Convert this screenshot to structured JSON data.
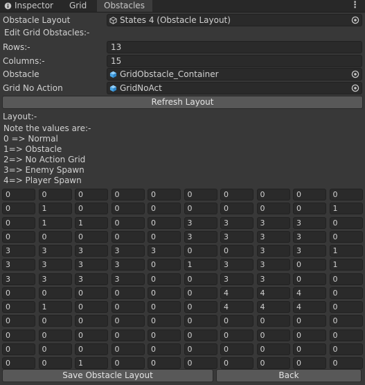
{
  "tabs": [
    {
      "label": "Inspector"
    },
    {
      "label": "Grid"
    },
    {
      "label": "Obstacles"
    }
  ],
  "fields": {
    "obstacle_layout_label": "Obstacle Layout",
    "obstacle_layout_value": "States 4 (Obstacle Layout)",
    "edit_grid_heading": "Edit Grid Obstacles:-",
    "rows_label": "Rows:-",
    "rows_value": "13",
    "columns_label": "Columns:-",
    "columns_value": "15",
    "obstacle_label": "Obstacle",
    "obstacle_value": "GridObstacle_Container",
    "grid_no_action_label": "Grid No Action",
    "grid_no_action_value": "GridNoAct"
  },
  "buttons": {
    "refresh": "Refresh Layout",
    "save": "Save Obstacle Layout",
    "back": "Back"
  },
  "legend": {
    "heading": "Layout:-",
    "note": "Note the values are:-",
    "items": [
      "0 => Normal",
      "1=> Obstacle",
      "2=> No Action Grid",
      "3=> Enemy Spawn",
      "4=> Player Spawn"
    ]
  },
  "grid": [
    [
      "0",
      "0",
      "0",
      "0",
      "0",
      "0",
      "0",
      "0",
      "0",
      "0"
    ],
    [
      "0",
      "1",
      "0",
      "0",
      "0",
      "0",
      "0",
      "0",
      "0",
      "1"
    ],
    [
      "0",
      "1",
      "1",
      "0",
      "0",
      "3",
      "3",
      "3",
      "3",
      "0"
    ],
    [
      "0",
      "0",
      "0",
      "0",
      "0",
      "3",
      "3",
      "3",
      "3",
      "0"
    ],
    [
      "3",
      "3",
      "3",
      "3",
      "3",
      "0",
      "0",
      "3",
      "3",
      "1"
    ],
    [
      "3",
      "3",
      "3",
      "3",
      "0",
      "1",
      "3",
      "3",
      "0",
      "1"
    ],
    [
      "3",
      "3",
      "3",
      "3",
      "0",
      "0",
      "3",
      "3",
      "0",
      "0"
    ],
    [
      "0",
      "0",
      "0",
      "0",
      "0",
      "0",
      "4",
      "4",
      "4",
      "0"
    ],
    [
      "0",
      "1",
      "0",
      "0",
      "0",
      "0",
      "4",
      "4",
      "4",
      "0"
    ],
    [
      "0",
      "0",
      "0",
      "0",
      "0",
      "0",
      "0",
      "0",
      "0",
      "0"
    ],
    [
      "0",
      "0",
      "0",
      "0",
      "0",
      "0",
      "0",
      "0",
      "0",
      "0"
    ],
    [
      "0",
      "0",
      "0",
      "0",
      "0",
      "0",
      "0",
      "0",
      "0",
      "0"
    ],
    [
      "0",
      "0",
      "1",
      "0",
      "0",
      "0",
      "0",
      "0",
      "0",
      "0"
    ]
  ]
}
